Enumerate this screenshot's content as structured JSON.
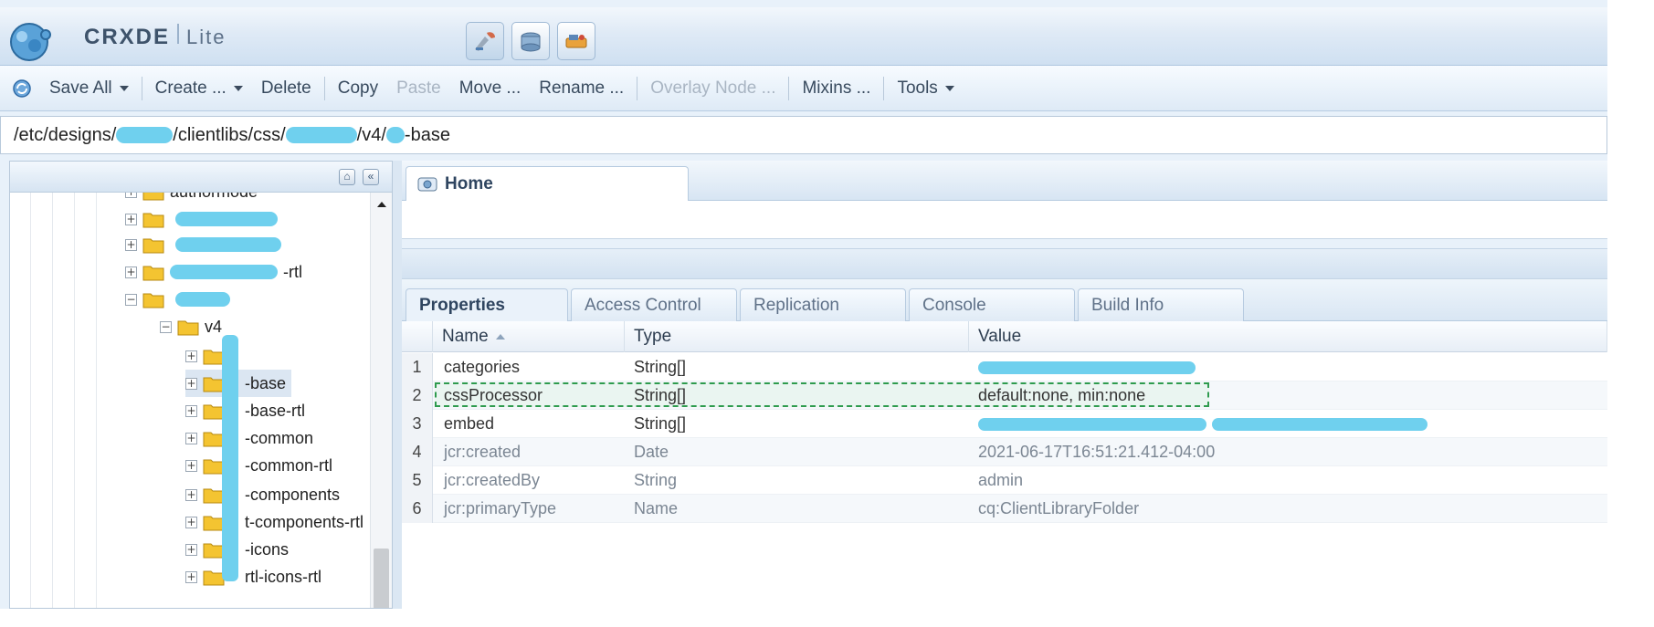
{
  "app": {
    "title_main": "CRXDE",
    "title_sub": "Lite",
    "logo_icon": "crx-logo-icon",
    "mode_buttons": [
      {
        "name": "develop-mode-icon"
      },
      {
        "name": "package-mode-icon"
      },
      {
        "name": "share-mode-icon"
      }
    ]
  },
  "toolbar": {
    "refresh_icon": "refresh-icon",
    "items": [
      {
        "label": "Save All",
        "dropdown": true,
        "enabled": true
      },
      {
        "label": "Create ...",
        "dropdown": true,
        "enabled": true
      },
      {
        "label": "Delete",
        "dropdown": false,
        "enabled": true
      },
      {
        "label": "Copy",
        "dropdown": false,
        "enabled": true
      },
      {
        "label": "Paste",
        "dropdown": false,
        "enabled": false
      },
      {
        "label": "Move ...",
        "dropdown": false,
        "enabled": true
      },
      {
        "label": "Rename ...",
        "dropdown": false,
        "enabled": true
      },
      {
        "label": "Overlay Node ...",
        "dropdown": false,
        "enabled": false
      },
      {
        "label": "Mixins ...",
        "dropdown": false,
        "enabled": true
      },
      {
        "label": "Tools",
        "dropdown": true,
        "enabled": true
      }
    ]
  },
  "path": {
    "seg1": "/etc/designs/",
    "seg2": "/clientlibs/css/",
    "seg3": "/v4/",
    "seg4": "-base"
  },
  "tree": {
    "nodes": [
      {
        "label": "authormode",
        "level": 0,
        "expanded": false
      },
      {
        "label": "",
        "level": 0,
        "expanded": false
      },
      {
        "label": "",
        "level": 0,
        "expanded": false
      },
      {
        "label": "-rtl",
        "level": 0,
        "expanded": false
      },
      {
        "label": "",
        "level": 0,
        "expanded": true
      },
      {
        "label": "v4",
        "level": 1,
        "expanded": true
      },
      {
        "label": "",
        "level": 2,
        "expanded": false
      },
      {
        "label": "-base",
        "level": 2,
        "expanded": false,
        "selected": true
      },
      {
        "label": "-base-rtl",
        "level": 2,
        "expanded": false
      },
      {
        "label": "-common",
        "level": 2,
        "expanded": false
      },
      {
        "label": "-common-rtl",
        "level": 2,
        "expanded": false
      },
      {
        "label": "-components",
        "level": 2,
        "expanded": false
      },
      {
        "label": "t-components-rtl",
        "level": 2,
        "expanded": false
      },
      {
        "label": "-icons",
        "level": 2,
        "expanded": false
      },
      {
        "label": "rtl-icons-rtl",
        "level": 2,
        "expanded": false
      }
    ]
  },
  "home_tab": {
    "label": "Home",
    "icon": "home-icon"
  },
  "sub_tabs": [
    {
      "label": "Properties",
      "active": true
    },
    {
      "label": "Access Control",
      "active": false
    },
    {
      "label": "Replication",
      "active": false
    },
    {
      "label": "Console",
      "active": false
    },
    {
      "label": "Build Info",
      "active": false
    }
  ],
  "grid": {
    "headers": {
      "name": "Name",
      "type": "Type",
      "value": "Value"
    },
    "rows": [
      {
        "num": "1",
        "name": "categories",
        "type": "String[]",
        "value": "",
        "protected": false
      },
      {
        "num": "2",
        "name": "cssProcessor",
        "type": "String[]",
        "value": "default:none, min:none",
        "protected": false,
        "focused": true
      },
      {
        "num": "3",
        "name": "embed",
        "type": "String[]",
        "value": "",
        "protected": false
      },
      {
        "num": "4",
        "name": "jcr:created",
        "type": "Date",
        "value": "2021-06-17T16:51:21.412-04:00",
        "protected": true
      },
      {
        "num": "5",
        "name": "jcr:createdBy",
        "type": "String",
        "value": "admin",
        "protected": true
      },
      {
        "num": "6",
        "name": "jcr:primaryType",
        "type": "Name",
        "value": "cq:ClientLibraryFolder",
        "protected": true
      }
    ]
  },
  "colors": {
    "accent": "#2f4560",
    "redaction": "#6fd0ee",
    "focus_border": "#2e9b4e"
  }
}
